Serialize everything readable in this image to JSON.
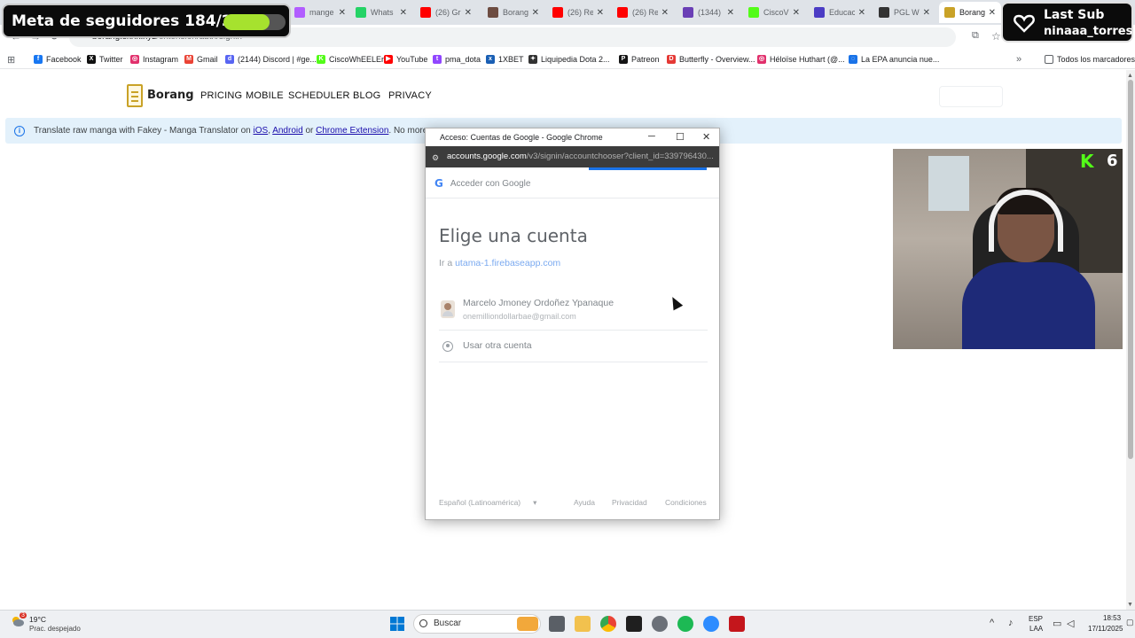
{
  "browser": {
    "tabs": [
      {
        "title": "mange",
        "color": "#b15dff"
      },
      {
        "title": "Whats",
        "color": "#25d366"
      },
      {
        "title": "(26) Gr",
        "color": "#ff0000"
      },
      {
        "title": "Borang",
        "color": "#6d4c41"
      },
      {
        "title": "(26) Re",
        "color": "#ff0000"
      },
      {
        "title": "(26) Re",
        "color": "#ff0000"
      },
      {
        "title": "(1344)",
        "color": "#6a3fb5"
      },
      {
        "title": "CiscoV",
        "color": "#53fc18"
      },
      {
        "title": "Educac",
        "color": "#4b3cc4"
      },
      {
        "title": "PGL W",
        "color": "#333333"
      },
      {
        "title": "Borang",
        "color": "#c9a227"
      }
    ],
    "address": {
      "host": "borang.skrlk.xyz",
      "path": "/extension/auth/signin"
    },
    "bookmarks": [
      {
        "label": "Facebook",
        "icon": "facebook-icon",
        "color": "#1877f2",
        "glyph": "f"
      },
      {
        "label": "Twitter",
        "icon": "x-icon",
        "color": "#111111",
        "glyph": "X"
      },
      {
        "label": "Instagram",
        "icon": "instagram-icon",
        "color": "#e1306c",
        "glyph": "◎"
      },
      {
        "label": "Gmail",
        "icon": "gmail-icon",
        "color": "#ea4335",
        "glyph": "M"
      },
      {
        "label": "(2144) Discord | #ge...",
        "icon": "discord-icon",
        "color": "#5865f2",
        "glyph": "d"
      },
      {
        "label": "CiscoWhEELEr",
        "icon": "kick-icon",
        "color": "#53fc18",
        "glyph": "K"
      },
      {
        "label": "YouTube",
        "icon": "youtube-icon",
        "color": "#ff0000",
        "glyph": "▶"
      },
      {
        "label": "pma_dota",
        "icon": "twitch-icon",
        "color": "#9146ff",
        "glyph": "t"
      },
      {
        "label": "1XBET",
        "icon": "1xbet-icon",
        "color": "#1a5fb4",
        "glyph": "x"
      },
      {
        "label": "Liquipedia Dota 2...",
        "icon": "liquipedia-icon",
        "color": "#333333",
        "glyph": "✦"
      },
      {
        "label": "Patreon",
        "icon": "patreon-icon",
        "color": "#141414",
        "glyph": "P"
      },
      {
        "label": "Butterfly - Overview...",
        "icon": "butterfly-icon",
        "color": "#e53935",
        "glyph": "D"
      },
      {
        "label": "Héloïse Huthart (@...",
        "icon": "instagram-icon",
        "color": "#e1306c",
        "glyph": "◎"
      },
      {
        "label": "La EPA anuncia nue...",
        "icon": "epa-icon",
        "color": "#1a73e8",
        "glyph": "◌"
      }
    ],
    "all_bookmarks_label": "Todos los marcadores"
  },
  "page": {
    "logo_text": "Borang",
    "nav": [
      "PRICING",
      "MOBILE",
      "SCHEDULER",
      "BLOG",
      "PRIVACY"
    ],
    "banner": {
      "prefix": "Translate raw manga with Fakey - Manga Translator on ",
      "ios": "iOS",
      "sep1": ", ",
      "android": "Android",
      "sep2": " or ",
      "chrome": "Chrome Extension",
      "suffix": ". No more wa"
    }
  },
  "popup": {
    "window_title": "Acceso: Cuentas de Google - Google Chrome",
    "url_host": "accounts.google.com",
    "url_path": "/v3/signin/accountchooser?client_id=339796430...",
    "header": "Acceder con Google",
    "heading": "Elige una cuenta",
    "goto_prefix": "Ir a ",
    "goto_link": "utama-1.firebaseapp.com",
    "account_name": "Marcelo Jmoney Ordoñez Ypanaque",
    "account_email": "onemilliondollarbae@gmail.com",
    "other_account": "Usar otra cuenta",
    "language": "Español (Latinoamérica)",
    "help": "Ayuda",
    "privacy": "Privacidad",
    "terms": "Condiciones"
  },
  "overlay": {
    "goal_text": "Meta de seguidores 184/250",
    "goal_progress": 0.736,
    "goal_color": "#a6e22e",
    "last_sub_title": "Last Sub",
    "last_sub_name": "ninaaa_torres",
    "kick_count": "6"
  },
  "taskbar": {
    "temp": "19°C",
    "weather_desc": "Prac. despejado",
    "weather_badge": "3",
    "search_label": "Buscar",
    "lang_top": "ESP",
    "lang_bottom": "LAA",
    "time": "18:53",
    "date": "17/11/2025"
  }
}
